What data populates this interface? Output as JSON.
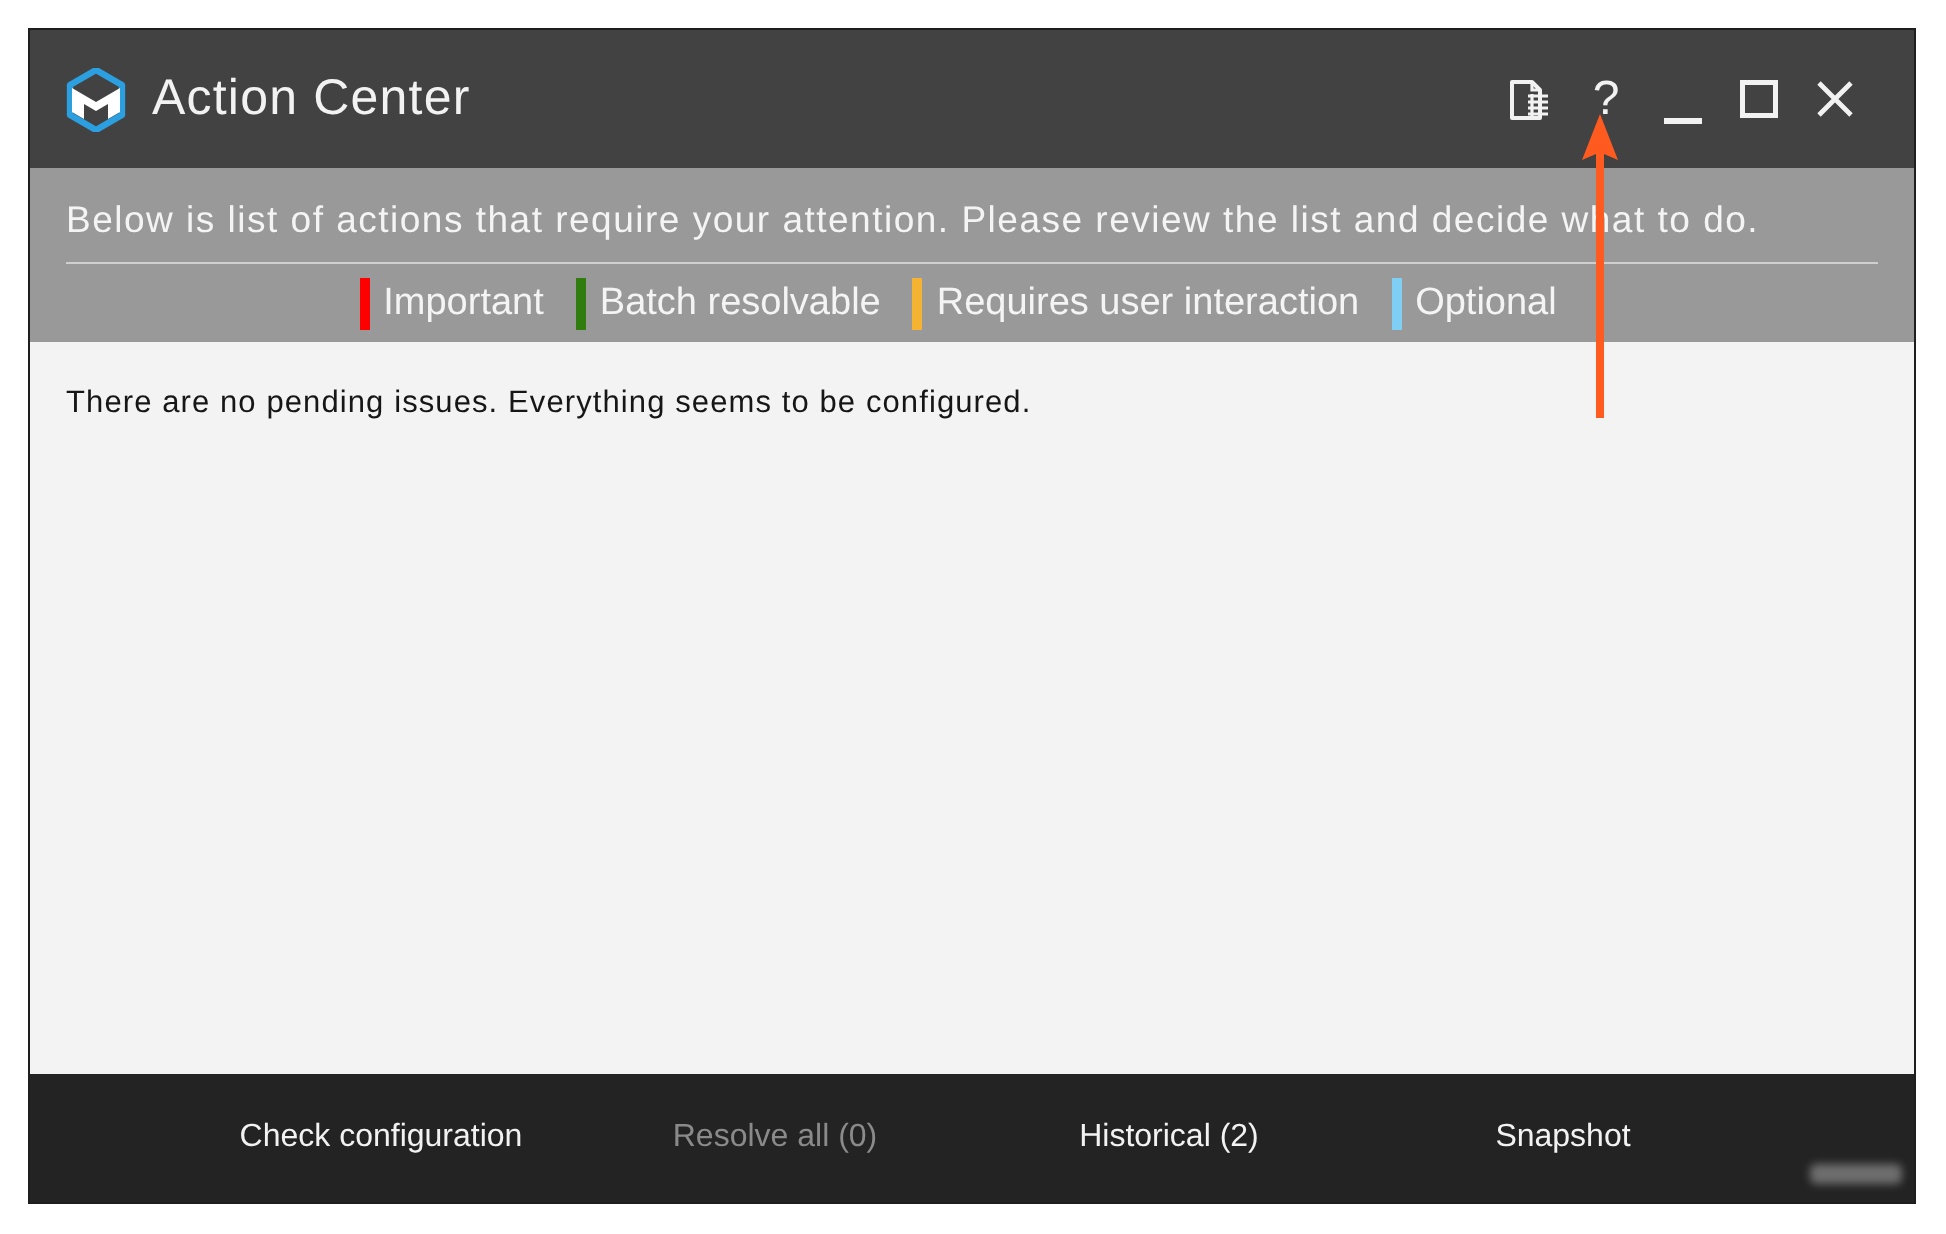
{
  "window": {
    "title": "Action Center",
    "help_button": "?"
  },
  "banner": {
    "message": "Below is list of actions that require your attention. Please review the list and decide what to do.",
    "legend": [
      {
        "label": "Important",
        "color": "#ff0000"
      },
      {
        "label": "Batch resolvable",
        "color": "#2e7d0e"
      },
      {
        "label": "Requires user interaction",
        "color": "#f5b333"
      },
      {
        "label": "Optional",
        "color": "#7fcff5"
      }
    ]
  },
  "content": {
    "message": "There are no pending issues. Everything seems to be configured."
  },
  "footer": {
    "buttons": [
      {
        "label": "Check configuration",
        "disabled": false
      },
      {
        "label": "Resolve all (0)",
        "disabled": true
      },
      {
        "label": "Historical (2)",
        "disabled": false
      },
      {
        "label": "Snapshot",
        "disabled": false
      }
    ]
  }
}
